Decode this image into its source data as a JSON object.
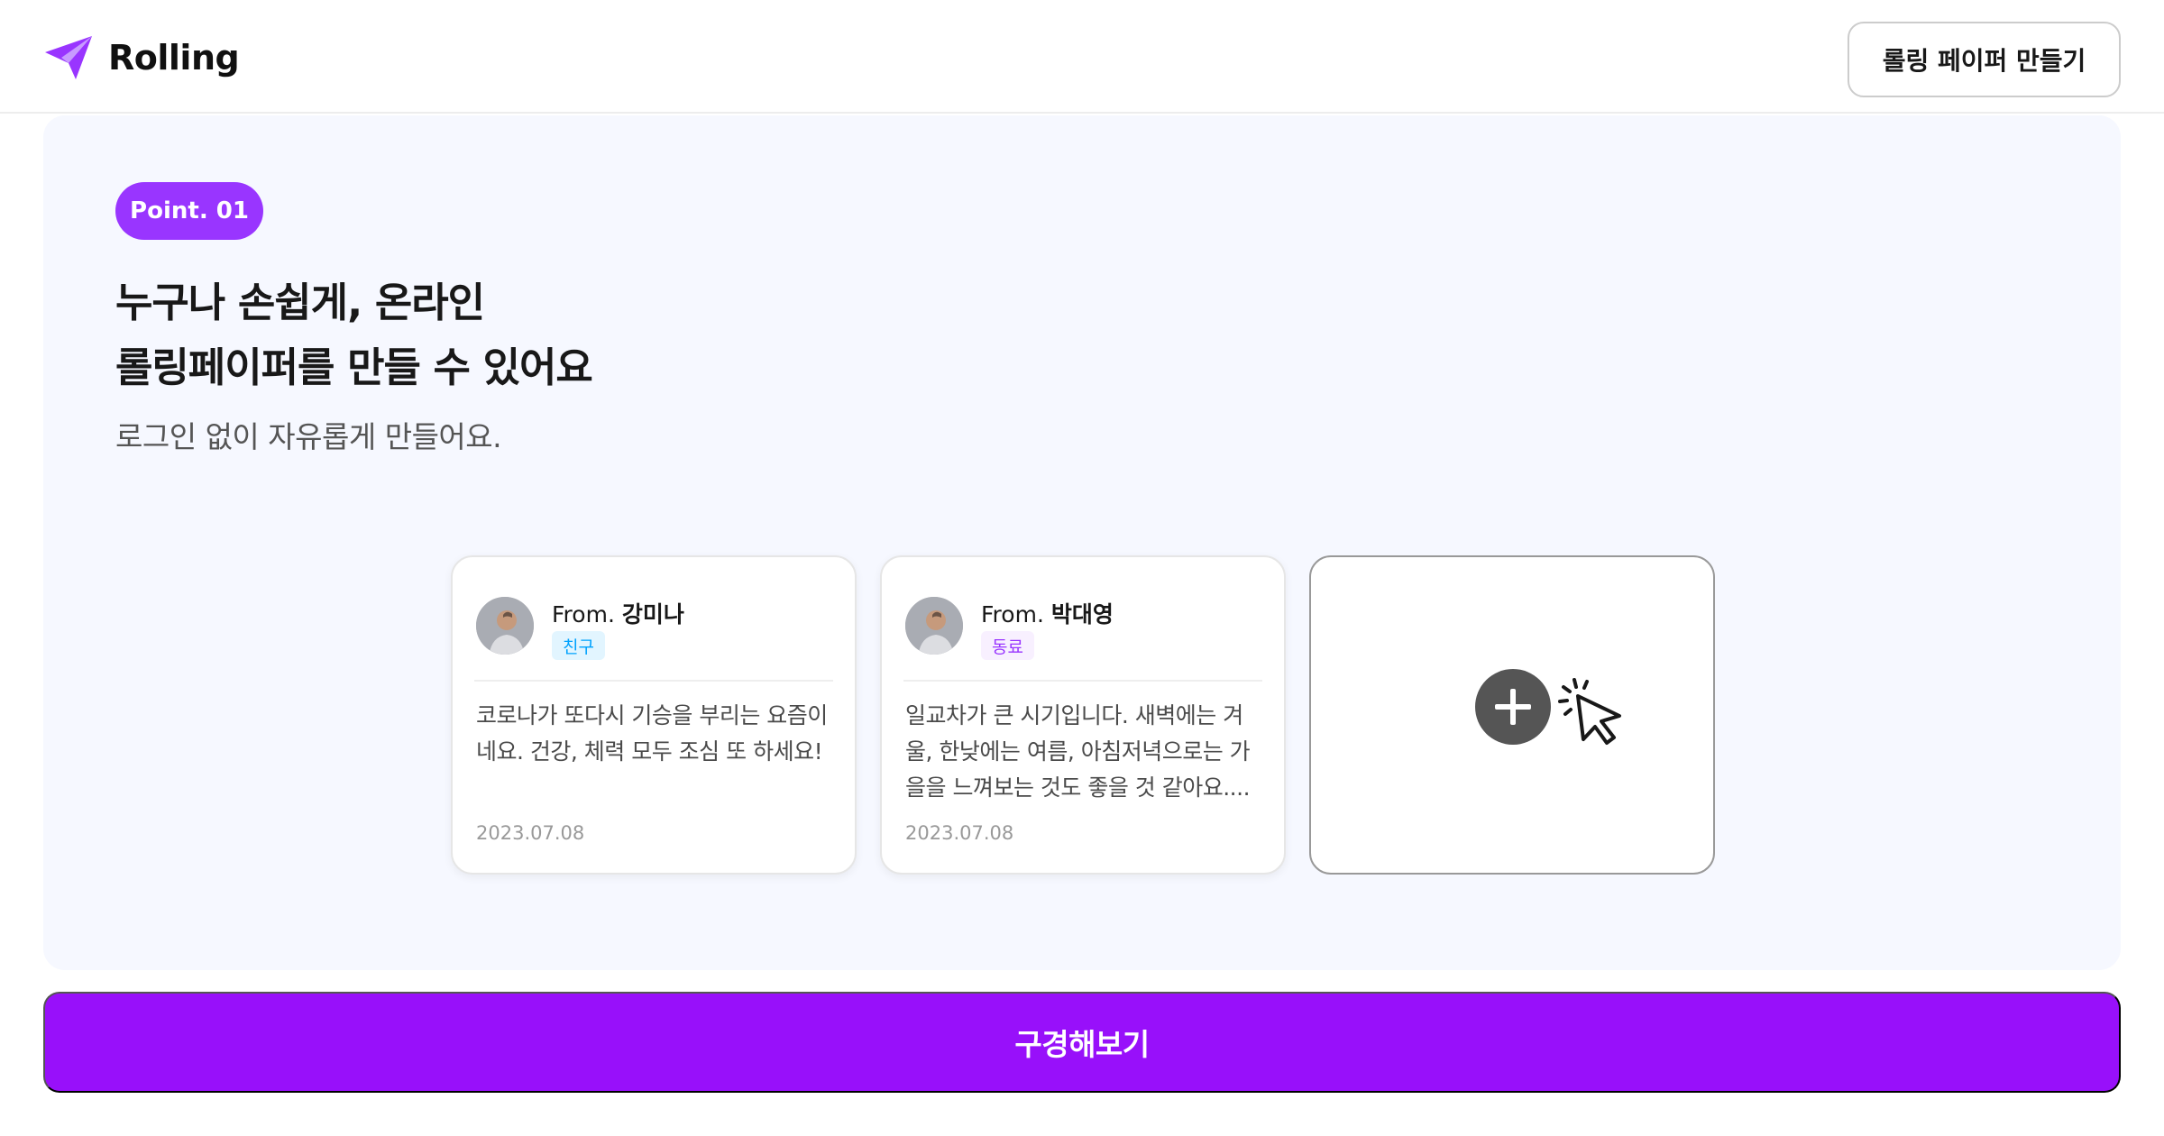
{
  "header": {
    "logo_text": "Rolling",
    "create_button": "롤링 페이퍼 만들기"
  },
  "section": {
    "badge": "Point. 01",
    "title_line1": "누구나 손쉽게, 온라인",
    "title_line2": "롤링페이퍼를 만들 수 있어요",
    "subtitle": "로그인 없이 자유롭게 만들어요."
  },
  "cards": [
    {
      "from_prefix": "From.",
      "from_name": "강미나",
      "relationship": "친구",
      "body_line1": "코로나가 또다시 기승을 부리는 요즘이",
      "body_line2": "네요. 건강, 체력 모두 조심 또 하세요!",
      "body_line3": "",
      "date": "2023.07.08"
    },
    {
      "from_prefix": "From.",
      "from_name": "박대영",
      "relationship": "동료",
      "body_line1": "일교차가 큰 시기입니다. 새벽에는 겨",
      "body_line2": "울, 한낮에는 여름, 아침저녁으로는 가",
      "body_line3": "을을 느껴보는 것도 좋을 것 같아요....",
      "date": "2023.07.08"
    }
  ],
  "cta": {
    "label": "구경해보기"
  },
  "colors": {
    "primary": "#9935ff",
    "cta": "#9810fa",
    "section_bg": "#f6f8ff",
    "friend_tag_text": "#00a2fe",
    "colleague_tag_text": "#9935ff"
  },
  "icons": {
    "logo": "paper-plane-icon",
    "add": "plus-circle-icon",
    "cursor": "pointer-click-icon"
  }
}
